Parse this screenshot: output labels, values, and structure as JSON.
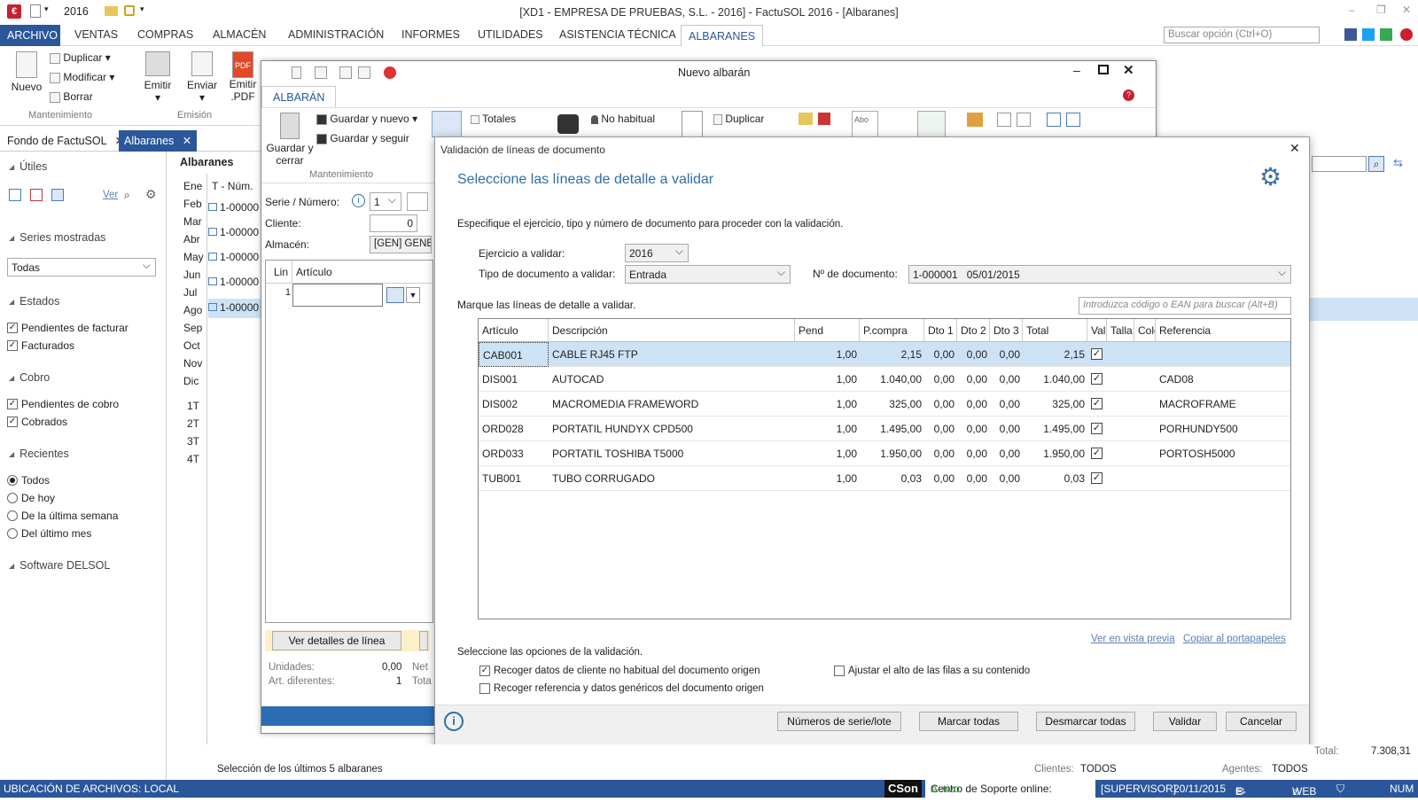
{
  "titlebar": {
    "year": "2016",
    "title": "[XD1 - EMPRESA DE PRUEBAS, S.L. - 2016] - FactuSOL 2016 - [Albaranes]"
  },
  "menu": {
    "archivo": "ARCHIVO",
    "items": [
      "VENTAS",
      "COMPRAS",
      "ALMACÉN",
      "ADMINISTRACIÓN",
      "INFORMES",
      "UTILIDADES",
      "ASISTENCIA TÉCNICA",
      "ALBARANES"
    ],
    "search_placeholder": "Buscar opción (Ctrl+O)"
  },
  "ribbon": {
    "nuevo": "Nuevo",
    "duplicar": "Duplicar",
    "modificar": "Modificar",
    "borrar": "Borrar",
    "mantenimiento": "Mantenimiento",
    "emitir": "Emitir",
    "enviar": "Enviar",
    "emitir_pdf": "Emitir\n.PDF",
    "emision": "Emisión",
    "pdf": "PDF"
  },
  "doctabs": [
    "Fondo de FactuSOL",
    "Albaranes"
  ],
  "sidebar": {
    "utiles": "Útiles",
    "ver": "Ver",
    "series": "Series mostradas",
    "series_value": "Todas",
    "estados": "Estados",
    "pend_fact": "Pendientes de facturar",
    "facturados": "Facturados",
    "cobro": "Cobro",
    "pend_cobro": "Pendientes de cobro",
    "cobrados": "Cobrados",
    "recientes": "Recientes",
    "todos": "Todos",
    "de_hoy": "De hoy",
    "ult_semana": "De la última semana",
    "ult_mes": "Del último mes",
    "software": "Software DELSOL"
  },
  "albaranes_panel": {
    "title": "Albaranes",
    "col": "T - Núm.",
    "months": [
      "Ene",
      "Feb",
      "Mar",
      "Abr",
      "May",
      "Jun",
      "Jul",
      "Ago",
      "Sep",
      "Oct",
      "Nov",
      "Dic"
    ],
    "quarters": [
      "1T",
      "2T",
      "3T",
      "4T"
    ],
    "rows": [
      "1-00000",
      "1-00000",
      "1-00000",
      "1-00000",
      "1-00000"
    ]
  },
  "nuevo_albaran": {
    "title": "Nuevo albarán",
    "tab": "ALBARÁN",
    "guardar_cerrar": "Guardar y\ncerrar",
    "guardar_nuevo": "Guardar y nuevo",
    "guardar_seguir": "Guardar y seguir",
    "mantenimiento": "Mantenimiento",
    "totales": "Totales",
    "no_habitual": "No habitual",
    "duplicar": "Duplicar",
    "abo": "Abo",
    "serie_label": "Serie / Número:",
    "serie_value": "1",
    "cliente_label": "Cliente:",
    "cliente_value": "0",
    "almacen_label": "Almacén:",
    "almacen_value": "[GEN]  GENE",
    "col_lin": "Lin",
    "col_articulo": "Artículo",
    "lin_value": "1",
    "ver_detalles": "Ver detalles de línea",
    "unidades_label": "Unidades:",
    "unidades_value": "0,00",
    "art_dif_label": "Art. diferentes:",
    "art_dif_value": "1",
    "net": "Net",
    "tota": "Tota"
  },
  "dialog": {
    "title": "Validación de líneas de documento",
    "heading": "Seleccione las líneas de detalle a validar",
    "intro": "Especifique el ejercicio, tipo y número de documento para proceder con la validación.",
    "ejercicio_label": "Ejercicio a validar:",
    "ejercicio_value": "2016",
    "tipo_label": "Tipo de documento a validar:",
    "tipo_value": "Entrada",
    "num_label": "Nº de documento:",
    "num_value": "1-000001   05/01/2015",
    "marque": "Marque las líneas de detalle a validar.",
    "search_placeholder": "Introduzca código o EAN para buscar (Alt+B)",
    "columns": [
      "Artículo",
      "Descripción",
      "Pend",
      "P.compra",
      "Dto 1",
      "Dto 2",
      "Dto 3",
      "Total",
      "Val",
      "Talla",
      "Colc",
      "Referencia"
    ],
    "rows": [
      {
        "articulo": "CAB001",
        "descripcion": "CABLE RJ45 FTP",
        "pend": "1,00",
        "pcompra": "2,15",
        "dto1": "0,00",
        "dto2": "0,00",
        "dto3": "0,00",
        "total": "2,15",
        "val": "✓",
        "referencia": ""
      },
      {
        "articulo": "DIS001",
        "descripcion": "AUTOCAD",
        "pend": "1,00",
        "pcompra": "1.040,00",
        "dto1": "0,00",
        "dto2": "0,00",
        "dto3": "0,00",
        "total": "1.040,00",
        "val": "✓",
        "referencia": "CAD08"
      },
      {
        "articulo": "DIS002",
        "descripcion": "MACROMEDIA FRAMEWORD",
        "pend": "1,00",
        "pcompra": "325,00",
        "dto1": "0,00",
        "dto2": "0,00",
        "dto3": "0,00",
        "total": "325,00",
        "val": "✓",
        "referencia": "MACROFRAME"
      },
      {
        "articulo": "ORD028",
        "descripcion": "PORTATIL HUNDYX CPD500",
        "pend": "1,00",
        "pcompra": "1.495,00",
        "dto1": "0,00",
        "dto2": "0,00",
        "dto3": "0,00",
        "total": "1.495,00",
        "val": "✓",
        "referencia": "PORHUNDY500"
      },
      {
        "articulo": "ORD033",
        "descripcion": "PORTATIL TOSHIBA T5000",
        "pend": "1,00",
        "pcompra": "1.950,00",
        "dto1": "0,00",
        "dto2": "0,00",
        "dto3": "0,00",
        "total": "1.950,00",
        "val": "✓",
        "referencia": "PORTOSH5000"
      },
      {
        "articulo": "TUB001",
        "descripcion": "TUBO CORRUGADO",
        "pend": "1,00",
        "pcompra": "0,03",
        "dto1": "0,00",
        "dto2": "0,00",
        "dto3": "0,00",
        "total": "0,03",
        "val": "✓",
        "referencia": ""
      }
    ],
    "vista_previa": "Ver en vista previa",
    "portapapeles": "Copiar al portapapeles",
    "opciones": "Seleccione las opciones de la validación.",
    "opt1": "Recoger datos de cliente no habitual del documento origen",
    "opt1_mark": "✓",
    "opt2": "Recoger referencia y datos genéricos del documento origen",
    "opt3": "Ajustar el alto de las filas a su contenido",
    "buttons": {
      "series": "Números de serie/lote",
      "marcar": "Marcar todas",
      "desmarcar": "Desmarcar todas",
      "validar": "Validar",
      "cancelar": "Cancelar"
    }
  },
  "bottom": {
    "seleccion": "Selección de los últimos 5 albaranes",
    "clientes_label": "Clientes:",
    "clientes_value": "TODOS",
    "agentes_label": "Agentes:",
    "agentes_value": "TODOS",
    "total_label": "Total:",
    "total_value": "7.308,31"
  },
  "status": {
    "ubicacion": "UBICACIÓN DE ARCHIVOS: LOCAL",
    "cson": "CSon",
    "soporte": "Centro de Soporte online:",
    "activo": "Activo",
    "supervisor": "[SUPERVISOR]",
    "fecha": "20/11/2015",
    "email": "E-MAIL",
    "web": "WEB",
    "num": "NUM"
  }
}
